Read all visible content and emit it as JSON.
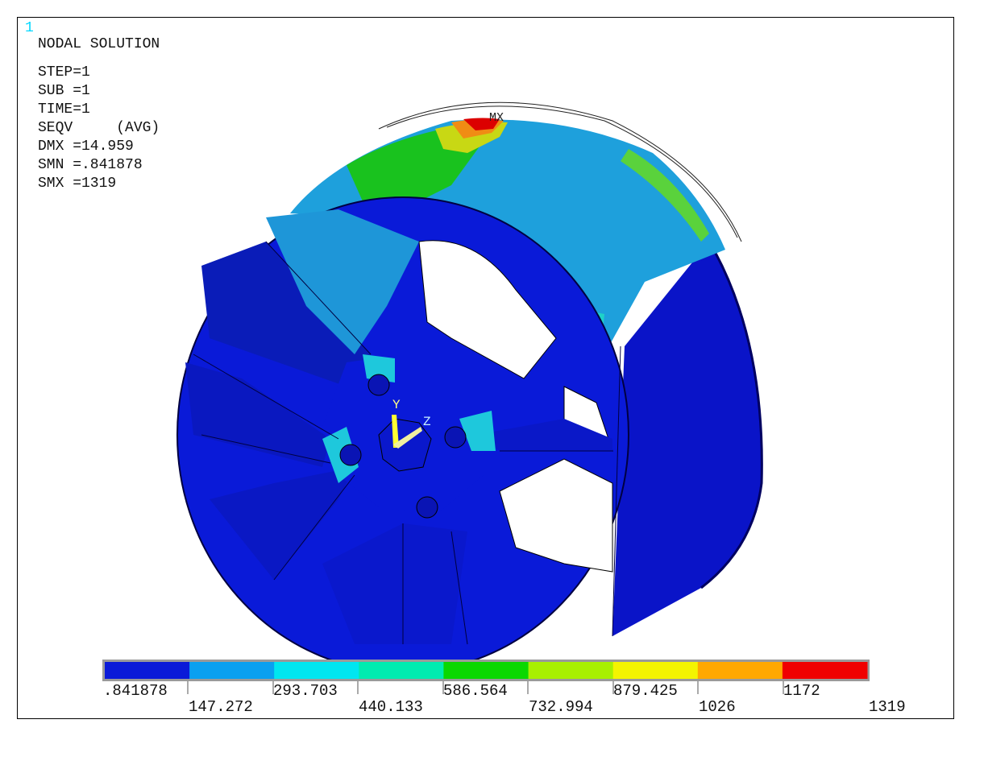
{
  "window_number": "1",
  "header": {
    "title": "NODAL SOLUTION",
    "lines": {
      "step": "STEP=1",
      "sub": "SUB =1",
      "time": "TIME=1",
      "seqv": "SEQV     (AVG)",
      "dmx": "DMX =14.959",
      "smn": "SMN =.841878",
      "smx": "SMX =1319"
    }
  },
  "markers": {
    "max": "MX",
    "y_axis": "Y",
    "z_axis": "Z"
  },
  "colors": {
    "window_number": "#00d8ff",
    "triad": "#ffff33",
    "band_0": "#0a1ad8",
    "band_1": "#0aa0f0",
    "band_2": "#00e6f0",
    "band_3": "#00ecb0",
    "band_4": "#0ad800",
    "band_5": "#a8f000",
    "band_6": "#f4f400",
    "band_7": "#ffa800",
    "band_8": "#f00000"
  },
  "legend": {
    "upper_labels": [
      ".841878",
      "293.703",
      "586.564",
      "879.425",
      "1172"
    ],
    "lower_labels": [
      "147.272",
      "440.133",
      "732.994",
      "1026",
      "1319"
    ],
    "band_count": 9
  }
}
